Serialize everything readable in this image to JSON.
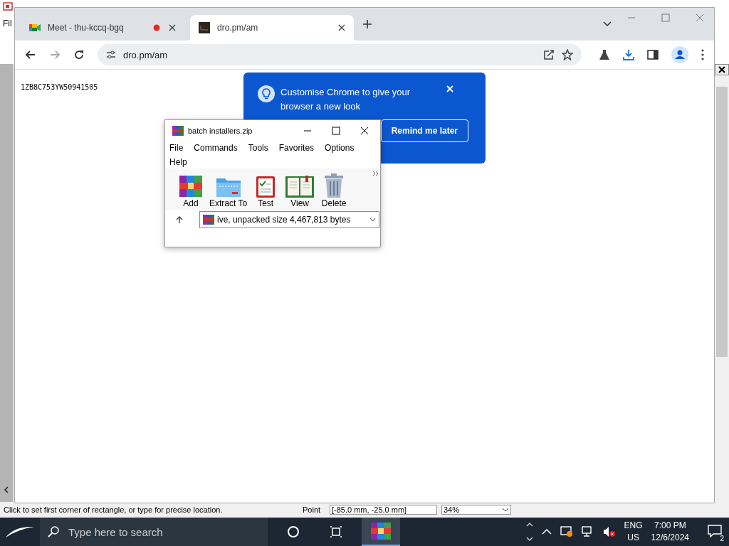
{
  "background_app": {
    "menu": [
      "Fil"
    ],
    "status_text": "Click to set first corner of rectangle, or type for precise location.",
    "point_label": "Point",
    "point_value": "[-85.0 mm, -25.0 mm]",
    "zoom": "34%"
  },
  "browser": {
    "tabs": [
      {
        "title": "Meet - thu-kccq-bgq",
        "selected": false,
        "recording": true
      },
      {
        "title": "dro.pm/am",
        "selected": true,
        "recording": false
      }
    ],
    "address": "dro.pm/am",
    "page_text": "1ZB8C753YW50941505",
    "promo": {
      "title": "Customise Chrome to give your browser a new look",
      "button": "Remind me later"
    }
  },
  "archiver": {
    "title": "batch installers.zip",
    "menu": [
      "File",
      "Commands",
      "Tools",
      "Favorites",
      "Options",
      "Help"
    ],
    "toolbar": [
      {
        "label": "Add",
        "kind": "add"
      },
      {
        "label": "Extract To",
        "kind": "extract"
      },
      {
        "label": "Test",
        "kind": "test"
      },
      {
        "label": "View",
        "kind": "view"
      },
      {
        "label": "Delete",
        "kind": "delete"
      }
    ],
    "path": "ive, unpacked size 4,467,813 bytes"
  },
  "taskbar": {
    "search_placeholder": "Type here to search",
    "language": "ENG",
    "region": "US",
    "time": "7:00 PM",
    "date": "12/6/2024",
    "notifications": "2"
  }
}
